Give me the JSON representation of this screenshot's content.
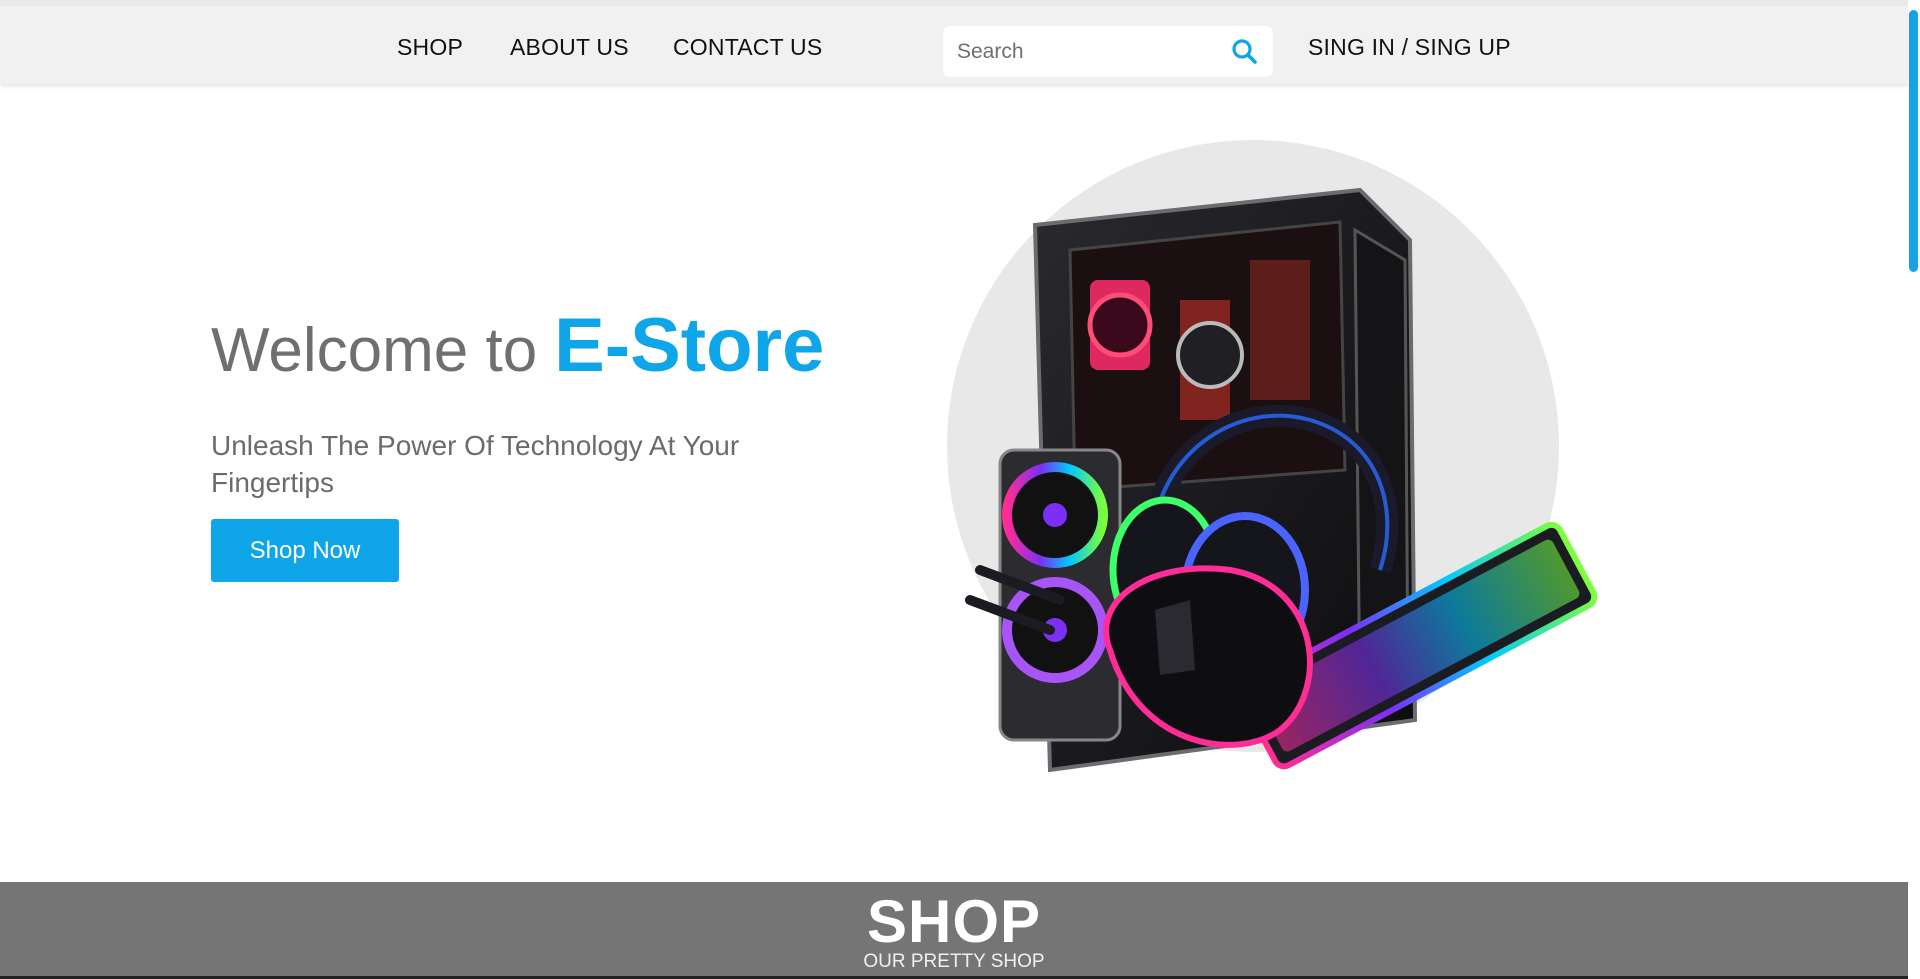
{
  "nav": {
    "links": [
      "SHOP",
      "ABOUT US",
      "CONTACT US"
    ],
    "search_placeholder": "Search",
    "search_icon": "search-icon",
    "auth_label": "SING IN / SING UP"
  },
  "hero": {
    "title_lead": "Welcome to",
    "title_brand": "E-Store",
    "subtitle": "Unleash The Power Of Technology At Your Fingertips",
    "cta_label": "Shop Now",
    "image": "gaming-pc-setup-image"
  },
  "shop_section": {
    "title": "SHOP",
    "subtitle": "OUR PRETTY SHOP"
  },
  "colors": {
    "accent": "#0ea5e9",
    "nav_background": "#f1f1f1",
    "section_background": "#757575",
    "text_gray": "#6f6f6f"
  }
}
